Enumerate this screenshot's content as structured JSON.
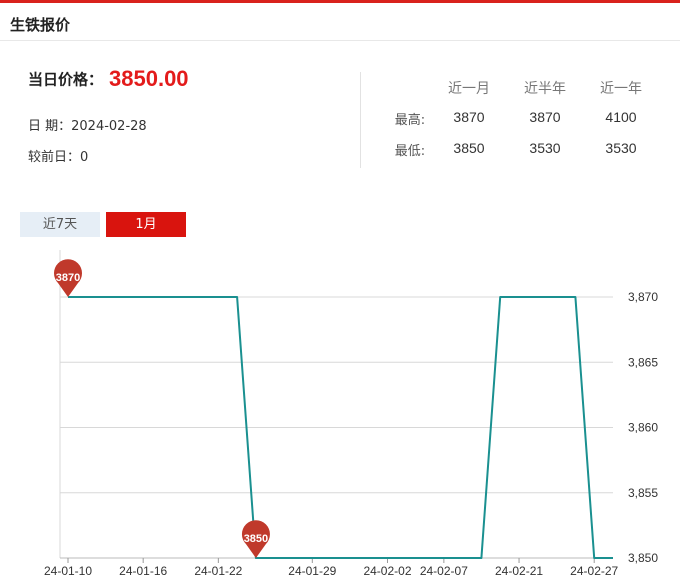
{
  "header": {
    "title": "生铁报价"
  },
  "summary": {
    "price_label": "当日价格：",
    "price_value": "3850.00",
    "date_line": "日 期：2024-02-28",
    "change_line": "较前日：0"
  },
  "stats": {
    "columns": [
      "近一月",
      "近半年",
      "近一年"
    ],
    "rows": [
      {
        "label": "最高:",
        "values": [
          "3870",
          "3870",
          "4100"
        ]
      },
      {
        "label": "最低:",
        "values": [
          "3850",
          "3530",
          "3530"
        ]
      }
    ]
  },
  "tabs": [
    {
      "label": "近7天",
      "active": false
    },
    {
      "label": "1月",
      "active": true
    }
  ],
  "colors": {
    "accent": "#d9140e",
    "price": "#e31b1b",
    "line": "#1a9090",
    "pin": "#c0392b"
  },
  "chart_data": {
    "type": "line",
    "x": [
      "24-01-10",
      "24-01-11",
      "24-01-12",
      "24-01-15",
      "24-01-16",
      "24-01-17",
      "24-01-18",
      "24-01-19",
      "24-01-22",
      "24-01-23",
      "24-01-24",
      "24-01-25",
      "24-01-26",
      "24-01-29",
      "24-01-30",
      "24-01-31",
      "24-02-01",
      "24-02-02",
      "24-02-05",
      "24-02-06",
      "24-02-07",
      "24-02-08",
      "24-02-19",
      "24-02-20",
      "24-02-21",
      "24-02-22",
      "24-02-23",
      "24-02-26",
      "24-02-27",
      "24-02-28"
    ],
    "series": [
      {
        "values": [
          3870,
          3870,
          3870,
          3870,
          3870,
          3870,
          3870,
          3870,
          3870,
          3870,
          3850,
          3850,
          3850,
          3850,
          3850,
          3850,
          3850,
          3850,
          3850,
          3850,
          3850,
          3850,
          3850,
          3870,
          3870,
          3870,
          3870,
          3870,
          3850,
          3850
        ]
      }
    ],
    "x_tick_labels": [
      "24-01-10",
      "24-01-16",
      "24-01-22",
      "24-01-29",
      "24-02-02",
      "24-02-07",
      "24-02-21",
      "24-02-27"
    ],
    "y_ticks": [
      3850,
      3855,
      3860,
      3865,
      3870
    ],
    "y_tick_labels": [
      "3,850",
      "3,855",
      "3,860",
      "3,865",
      "3,870"
    ],
    "ylim": [
      3850,
      3870
    ],
    "grid": true,
    "y_axis_side": "right",
    "markers": [
      {
        "label": "3870",
        "x": "24-01-10",
        "y": 3870
      },
      {
        "label": "3850",
        "x": "24-01-24",
        "y": 3850
      }
    ]
  }
}
